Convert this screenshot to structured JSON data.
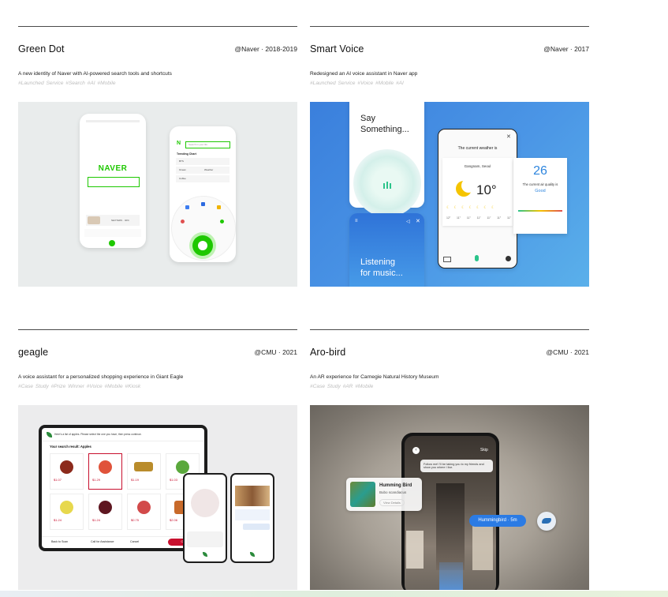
{
  "projects": [
    {
      "title": "Green Dot",
      "meta": "@Naver · 2018-2019",
      "description": "A new identity of Naver with AI-powered search tools and shortcuts",
      "tags": "#Launched Service  #Search  #AI  #Mobile",
      "screen": {
        "logo": "NAVER",
        "logo_small": "N",
        "search_placeholder": "Search in your life",
        "trending_label": "Trending Chart",
        "trending_items": [
          "BTS",
          "Ocean",
          "Weather",
          "Coffee"
        ],
        "banner": "NEXTERS · 40%"
      }
    },
    {
      "title": "Smart Voice",
      "meta": "@Naver · 2017",
      "description": "Redesigned an AI voice assistant in Naver app",
      "tags": "#Launched Service  #Voice  #Mobile  #AI",
      "screen": {
        "say_line1": "Say",
        "say_line2": "Something...",
        "listen_line1": "Listening",
        "listen_line2": "for music...",
        "weather_heading": "The current weather is",
        "location": "Gangnam, Seoul",
        "temperature": "10°",
        "air_value": "26",
        "air_heading": "The current air quality is",
        "air_status": "Good",
        "forecast_temps": [
          "12°",
          "11°",
          "11°",
          "11°",
          "11°",
          "11°",
          "11°"
        ]
      }
    },
    {
      "title": "geagle",
      "meta": "@CMU · 2021",
      "description": "A voice assistant for a personalized shopping experience in Giant Eagle",
      "tags": "#Case Study  #Prize Winner  #Voice  #Mobile  #Kiosk",
      "screen": {
        "header_text": "Here's a list of apples. Please select the one you have, then press continue.",
        "result_label": "Your search result: Apples",
        "prices": [
          "$1.07",
          "$1.29",
          "$1.19",
          "$1.03",
          "$1.24",
          "$1.24",
          "$0.75",
          "$2.06"
        ],
        "back_label": "Back to Scan",
        "assist_label": "Call for Assistance",
        "cancel_label": "Cancel",
        "continue_label": "Con"
      }
    },
    {
      "title": "Aro-bird",
      "meta": "@CMU · 2021",
      "description": "An AR experience for Carnegie Natural History Museum",
      "tags": "#Case Study  #AR  #Mobile",
      "screen": {
        "skip_label": "Skip",
        "bubble_text": "Follow me! I'll be taking you to my friends and show you where I live.",
        "bird_name": "Humming Bird",
        "bird_latin": "Bubo scandiacus",
        "view_details": "View Details",
        "distance_pill": "Hummingbird · 5m"
      }
    }
  ],
  "colors": {
    "naver_green": "#1ec800",
    "voice_blue": "#4a86e8",
    "geagle_red": "#c8102e",
    "aro_blue": "#2b7be4"
  }
}
